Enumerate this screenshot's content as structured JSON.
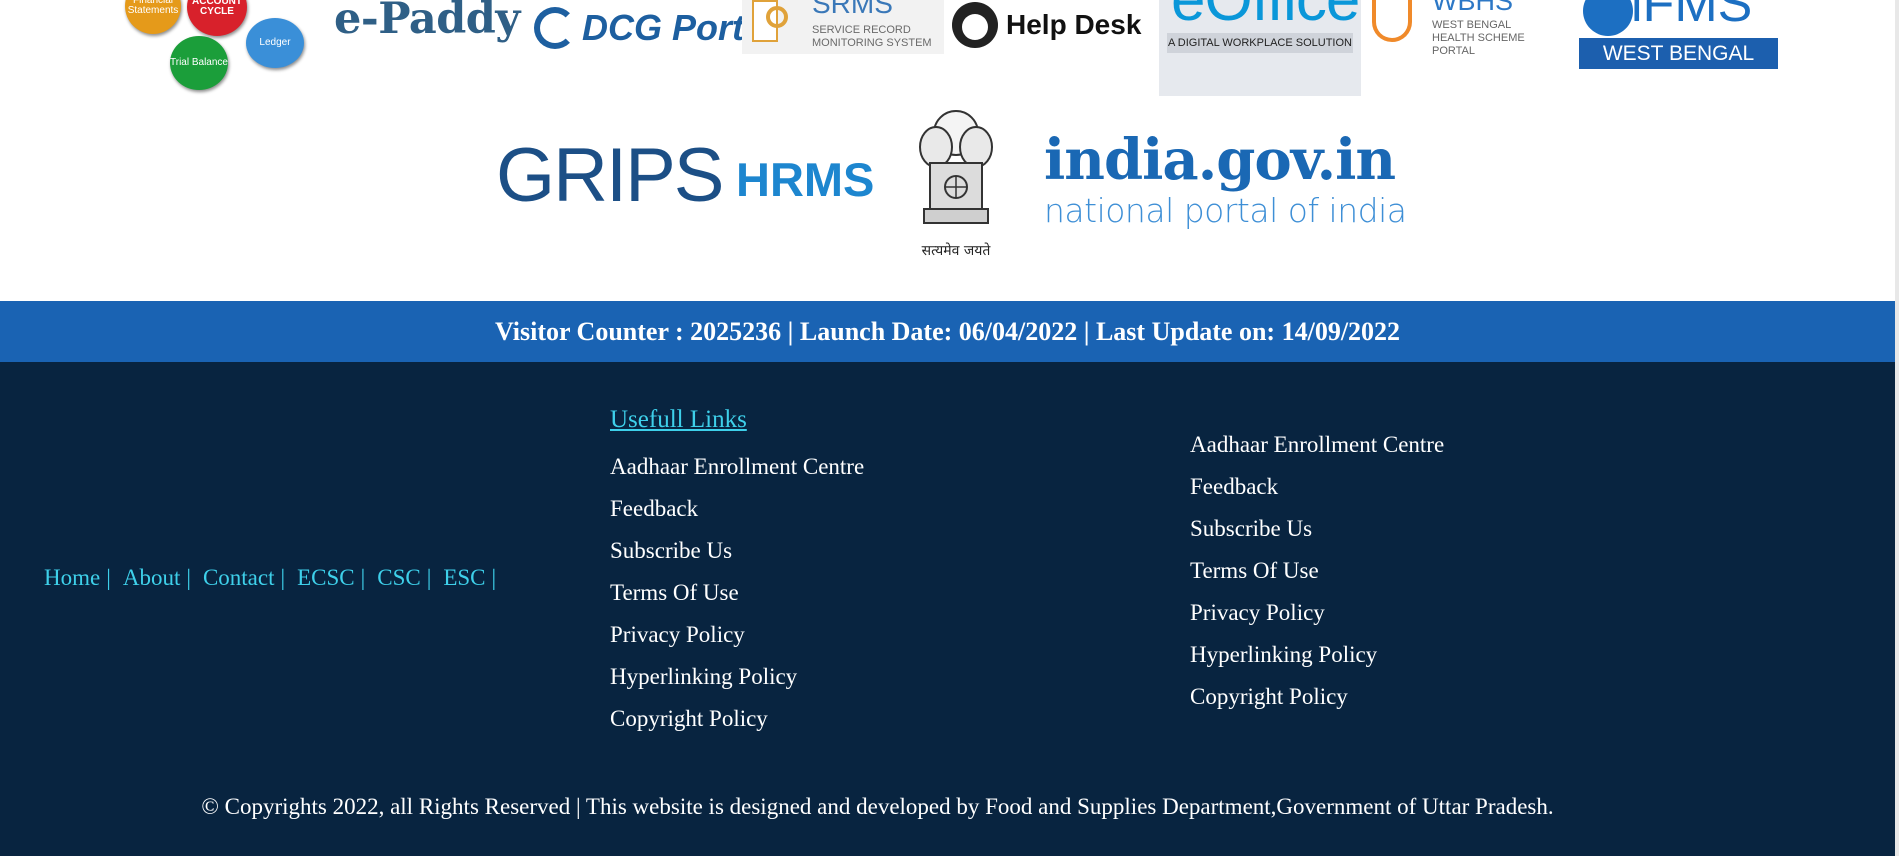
{
  "logos": {
    "cycle": {
      "balls": [
        "Financial Statements",
        "ACCOUNT CYCLE",
        "Trial Balance",
        "Ledger"
      ]
    },
    "epaddy": "e-Paddy",
    "dcg": "DCG Portal",
    "srms": {
      "title": "SRMS",
      "subtitle_line1": "SERVICE RECORD",
      "subtitle_line2": "MONITORING SYSTEM"
    },
    "help_desk": "Help Desk",
    "eoffice": {
      "word": "eOffice",
      "tagline": "A DIGITAL WORKPLACE SOLUTION"
    },
    "wbhs": {
      "title": "WBHS",
      "line1": "WEST BENGAL",
      "line2": "HEALTH SCHEME PORTAL"
    },
    "ifms": {
      "word": "iFMS",
      "band": "WEST BENGAL"
    },
    "grips": "GRIPS",
    "hrms": "HRMS",
    "emblem_caption": "सत्यमेव जयते",
    "indiagov": {
      "line1": "india.gov.in",
      "line2": "national portal of india"
    }
  },
  "counter": {
    "text": "Visitor Counter : 2025236 | Launch Date: 06/04/2022 | Last Update on: 14/09/2022"
  },
  "footer": {
    "nav": [
      "Home",
      "About",
      "Contact",
      "ECSC",
      "CSC",
      "ESC"
    ],
    "nav_separator": "|",
    "useful_links_heading": "Usefull Links",
    "links_col1": [
      "Aadhaar Enrollment Centre",
      "Feedback",
      "Subscribe Us",
      "Terms Of Use",
      "Privacy Policy",
      "Hyperlinking Policy",
      "Copyright Policy"
    ],
    "links_col2": [
      "Aadhaar Enrollment Centre",
      "Feedback",
      "Subscribe Us",
      "Terms Of Use",
      "Privacy Policy",
      "Hyperlinking Policy",
      "Copyright Policy"
    ],
    "copyright": "© Copyrights 2022, all Rights Reserved | This website is designed and developed by Food and Supplies Department,Government of Uttar Pradesh."
  },
  "colors": {
    "counter_band": "#1a63b3",
    "footer_bg": "#082440",
    "link_accent": "#3ed0ea"
  }
}
